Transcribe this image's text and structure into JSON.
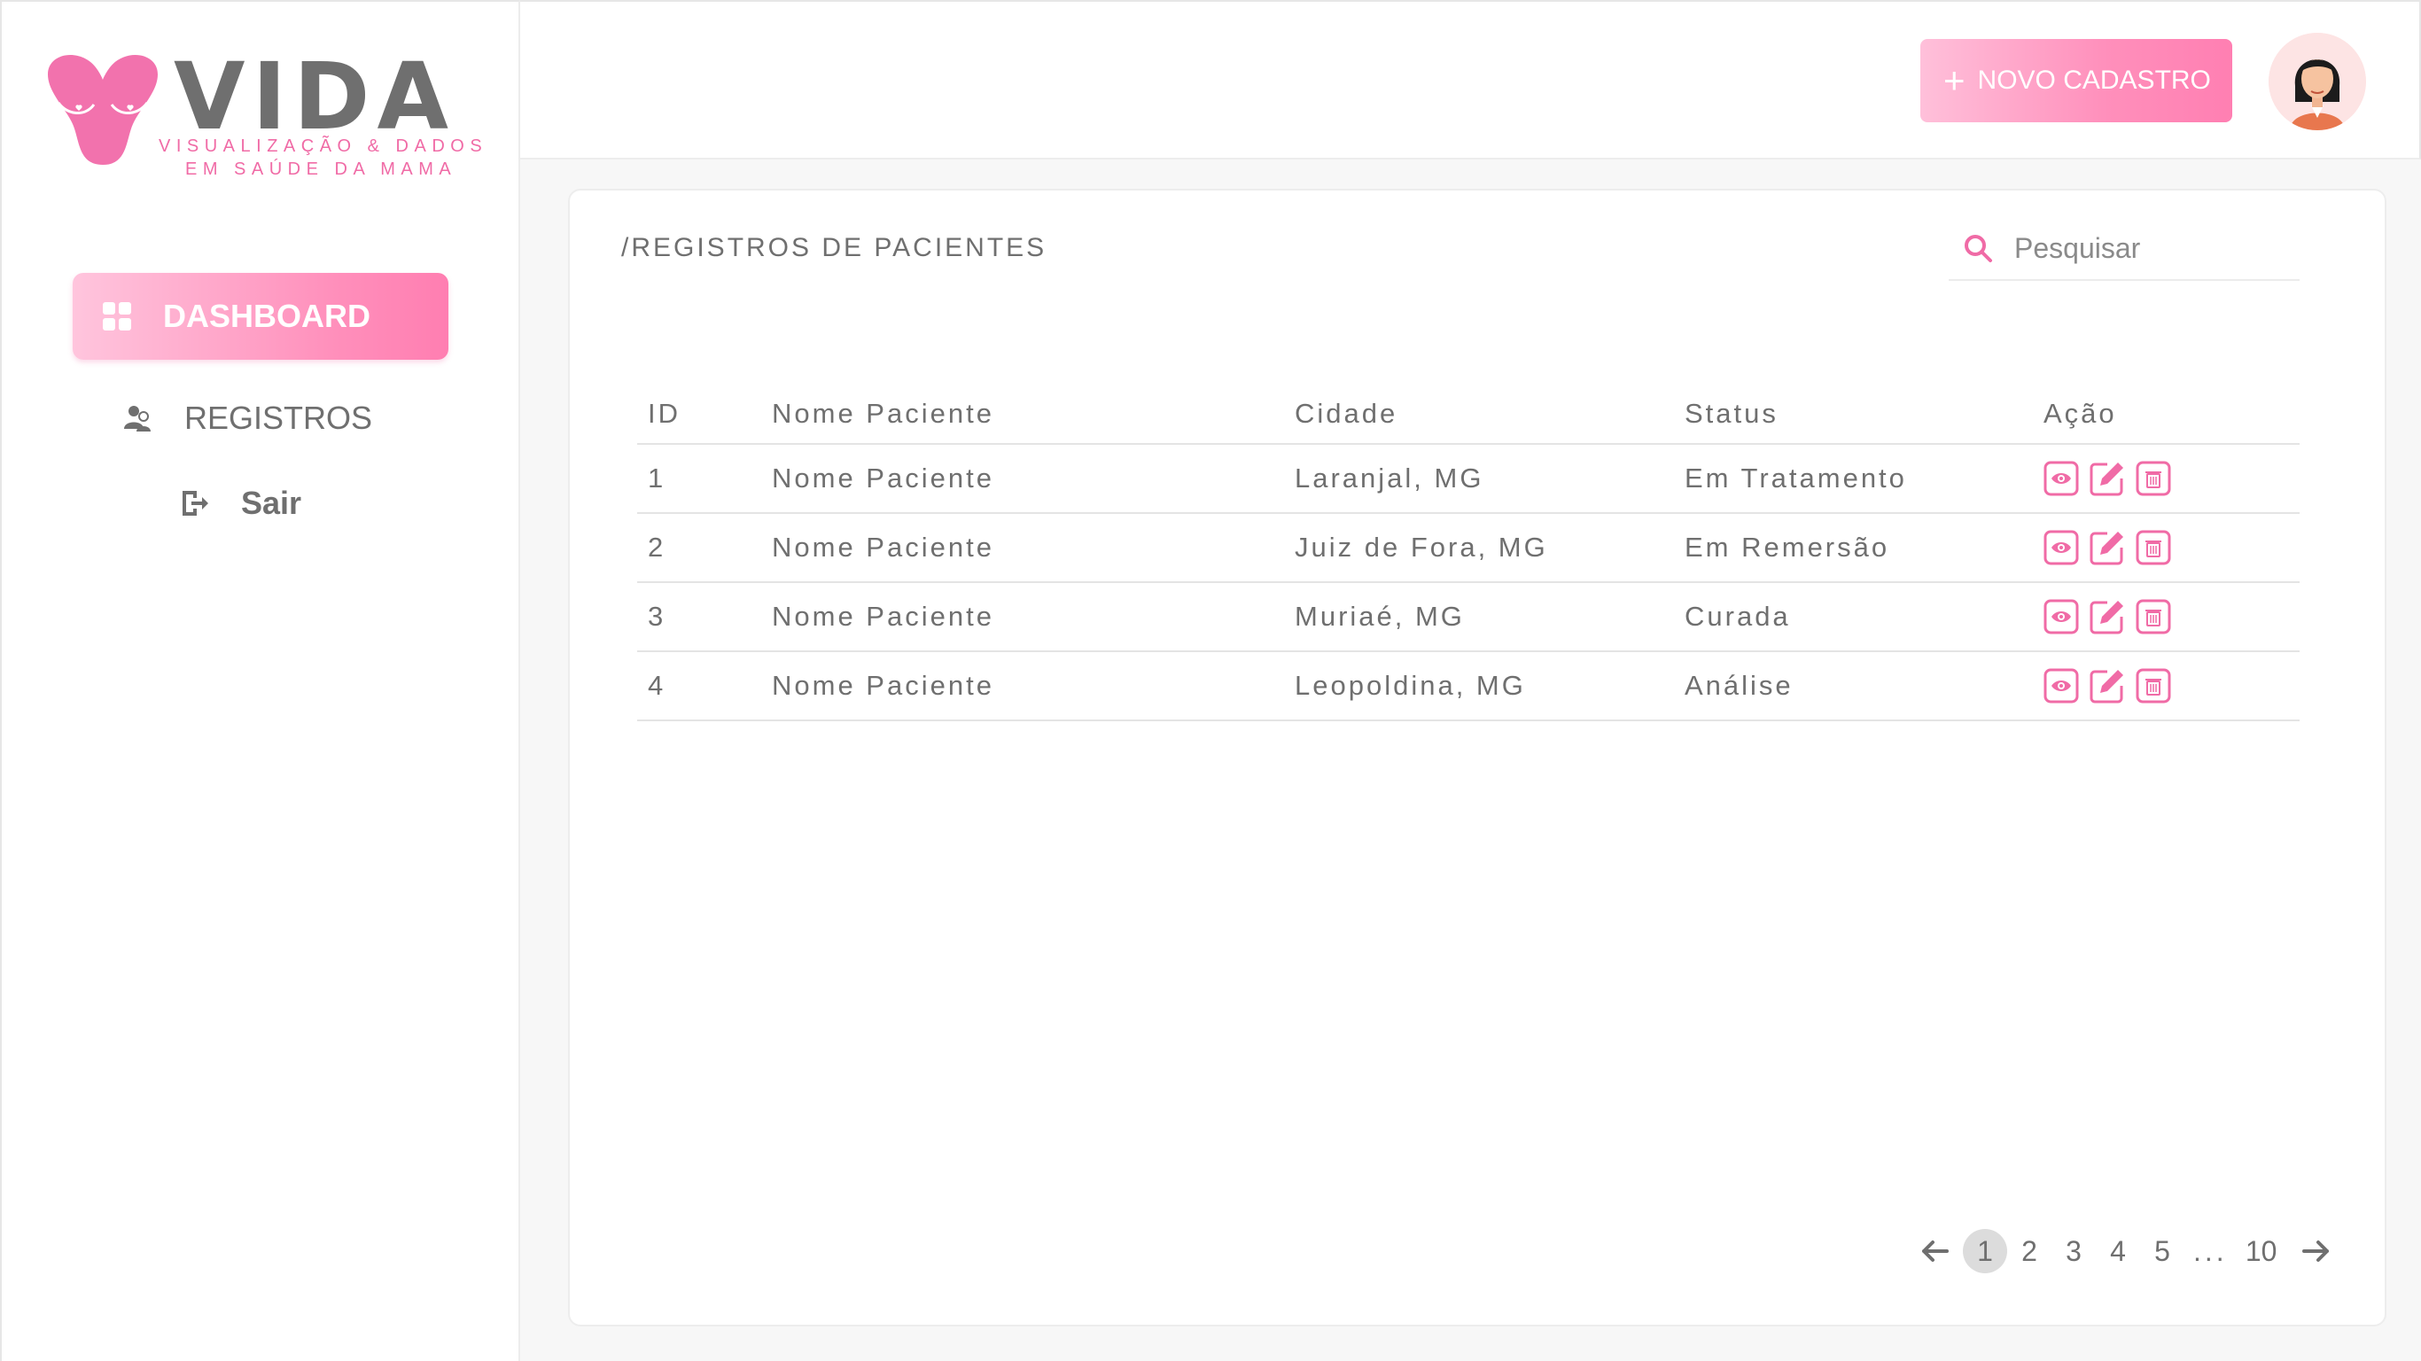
{
  "brand": {
    "name": "VIDA",
    "tagline_line1": "VISUALIZAÇÃO & DADOS",
    "tagline_line2": "EM SAÚDE DA MAMA"
  },
  "sidebar": {
    "items": [
      {
        "label": "DASHBOARD",
        "icon": "grid-icon",
        "active": true
      },
      {
        "label": "REGISTROS",
        "icon": "users-icon",
        "active": false
      },
      {
        "label": "Sair",
        "icon": "logout-icon",
        "active": false
      }
    ]
  },
  "header": {
    "new_button_label": "NOVO CADASTRO",
    "avatar": "user-avatar"
  },
  "main": {
    "breadcrumb": "/REGISTROS DE PACIENTES",
    "search_placeholder": "Pesquisar",
    "table": {
      "headers": [
        "ID",
        "Nome Paciente",
        "Cidade",
        "Status",
        "Ação"
      ],
      "rows": [
        {
          "id": "1",
          "name": "Nome Paciente",
          "city": "Laranjal, MG",
          "status": "Em Tratamento"
        },
        {
          "id": "2",
          "name": "Nome Paciente",
          "city": "Juiz de Fora, MG",
          "status": "Em Remersão"
        },
        {
          "id": "3",
          "name": "Nome Paciente",
          "city": "Muriaé, MG",
          "status": "Curada"
        },
        {
          "id": "4",
          "name": "Nome Paciente",
          "city": "Leopoldina, MG",
          "status": "Análise"
        }
      ],
      "actions": [
        "view-icon",
        "edit-icon",
        "delete-icon"
      ]
    },
    "pagination": {
      "pages": [
        "1",
        "2",
        "3",
        "4",
        "5"
      ],
      "ellipsis": "...",
      "last": "10",
      "current": "1"
    }
  },
  "colors": {
    "accent": "#f06ba6",
    "accent_gradient_start": "#ffc5dd",
    "accent_gradient_end": "#ff7eb1",
    "text": "#6f6f6f"
  }
}
